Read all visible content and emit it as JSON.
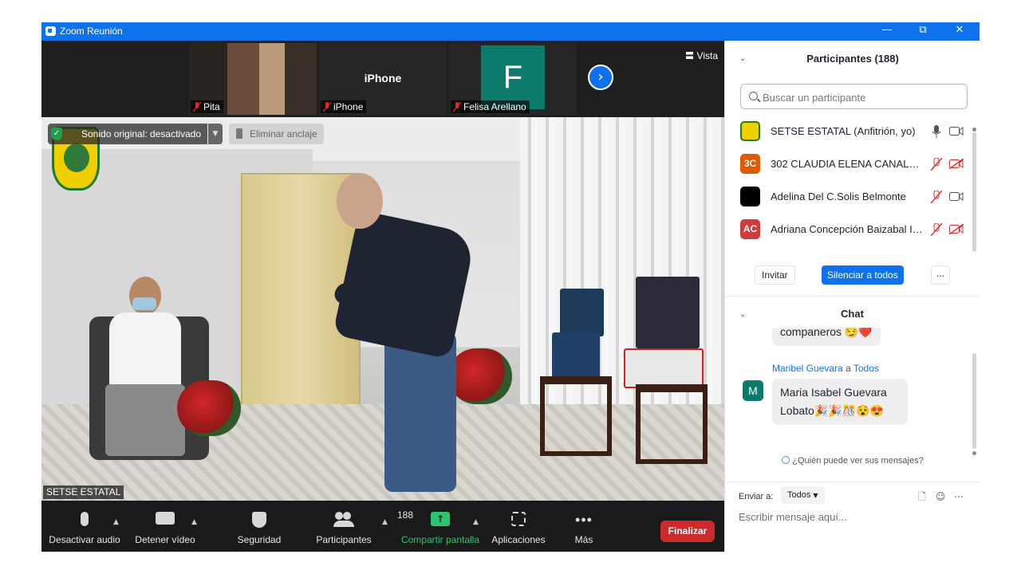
{
  "window": {
    "title": "Zoom Reunión",
    "controls": {
      "minimize": "—",
      "restore": "⧉",
      "close": "✕"
    },
    "accent": "#0e72ed"
  },
  "video": {
    "thumbnails": [
      {
        "name": "Pita",
        "muted": true,
        "kind": "video"
      },
      {
        "name": "iPhone",
        "label": "iPhone",
        "muted": true,
        "kind": "name-only"
      },
      {
        "name": "Felisa Arellano",
        "initial": "F",
        "muted": true,
        "kind": "avatar",
        "color": "#0b7c6b"
      }
    ],
    "view_label": "Vista",
    "next_icon": "chevron-right-icon",
    "original_sound": "Sonido original: desactivado",
    "unpin": "Eliminar anclaje",
    "speaker_name": "SETSE ESTATAL"
  },
  "toolbar": {
    "mute_label": "Desactivar audio",
    "video_label": "Detener vídeo",
    "security_label": "Seguridad",
    "participants_label": "Participantes",
    "participants_count": "188",
    "share_label": "Compartir pantalla",
    "share_color": "#28c76f",
    "apps_label": "Aplicaciones",
    "more_label": "Más",
    "end_label": "Finalizar",
    "end_color": "#cc2b2b"
  },
  "participants": {
    "title": "Participantes (188)",
    "search_placeholder": "Buscar un participante",
    "list": [
      {
        "name": "SETSE ESTATAL (Anfitrión, yo)",
        "avatar": "",
        "color": "#f0d000",
        "mic": "on",
        "cam": "on"
      },
      {
        "name": "302 CLAUDIA ELENA CANALES ...",
        "avatar": "3C",
        "color": "#e05a00",
        "mic": "off",
        "cam": "off"
      },
      {
        "name": "Adelina Del C.Solis Belmonte",
        "avatar": "",
        "color": "#000000",
        "mic": "off",
        "cam": "on"
      },
      {
        "name": "Adriana Concepción Baizabal Ib...",
        "avatar": "AC",
        "color": "#d13b3b",
        "mic": "off",
        "cam": "off"
      }
    ],
    "invite": "Invitar",
    "mute_all": "Silenciar a todos",
    "more": "..."
  },
  "chat": {
    "title": "Chat",
    "prev_message": "companeros 😏❤️",
    "sender": "Maribel Guevara",
    "to_word": "a",
    "recipient": "Todos",
    "avatar_initial": "M",
    "message": "Maria Isabel Guevara Lobato🎉🎉🎊😵😍",
    "who_sees": "¿Quién puede ver sus mensajes?",
    "send_to_label": "Enviar a:",
    "send_to_value": "Todos",
    "placeholder": "Escribir mensaje aquí..."
  }
}
